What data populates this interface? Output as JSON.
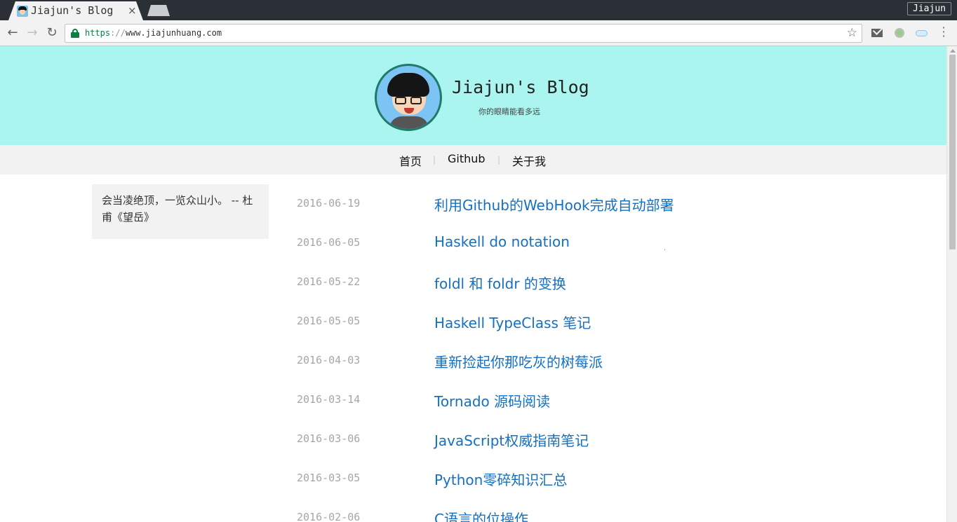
{
  "browser": {
    "tab_title": "Jiajun's Blog",
    "tab_close": "×",
    "profile_name": "Jiajun",
    "url_scheme": "https",
    "url_sep": "://",
    "url_host": "www.jiajunhuang.com",
    "icons": [
      "back-icon",
      "forward-icon",
      "reload-icon",
      "lock-icon",
      "star-icon",
      "mail-icon",
      "extension-icon",
      "cloud-icon",
      "menu-icon"
    ]
  },
  "header": {
    "title": "Jiajun's Blog",
    "subtitle": "你的眼睛能看多远",
    "background": "#aaf5ef"
  },
  "nav": {
    "items": [
      {
        "label": "首页"
      },
      {
        "label": "Github"
      },
      {
        "label": "关于我"
      }
    ],
    "separator": "|"
  },
  "sidebar": {
    "quote": "会当凌绝顶，一览众山小。 -- 杜甫《望岳》"
  },
  "posts": [
    {
      "date": "2016-06-19",
      "title": "利用Github的WebHook完成自动部署"
    },
    {
      "date": "2016-06-05",
      "title": "Haskell do notation"
    },
    {
      "date": "2016-05-22",
      "title": "foldl 和 foldr 的变换"
    },
    {
      "date": "2016-05-05",
      "title": "Haskell TypeClass 笔记"
    },
    {
      "date": "2016-04-03",
      "title": "重新捡起你那吃灰的树莓派"
    },
    {
      "date": "2016-03-14",
      "title": "Tornado 源码阅读"
    },
    {
      "date": "2016-03-06",
      "title": "JavaScript权威指南笔记"
    },
    {
      "date": "2016-03-05",
      "title": "Python零碎知识汇总"
    },
    {
      "date": "2016-02-06",
      "title": "C语言的位操作"
    }
  ],
  "colors": {
    "link": "#1470c2",
    "date": "#a6a6a6",
    "chrome_dark": "#2b3037"
  }
}
